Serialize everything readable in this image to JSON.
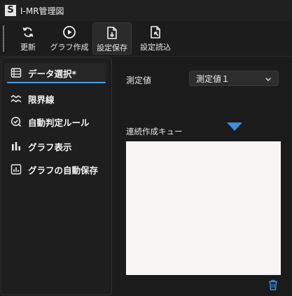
{
  "window": {
    "logo_letter": "S",
    "title": "I-MR管理図"
  },
  "toolbar": {
    "refresh_label": "更新",
    "create_chart_label": "グラフ作成",
    "save_settings_label": "設定保存",
    "load_settings_label": "設定読込"
  },
  "sidebar": {
    "items": [
      {
        "label": "データ選択*",
        "icon": "table-icon",
        "selected": true
      },
      {
        "label": "限界線",
        "icon": "wave-lines-icon"
      },
      {
        "label": "自動判定ルール",
        "icon": "check-circle-icon"
      },
      {
        "label": "グラフ表示",
        "icon": "bar-chart-icon"
      },
      {
        "label": "グラフの自動保存",
        "icon": "chart-save-icon"
      }
    ]
  },
  "main": {
    "measurement_label": "測定値",
    "measurement_select_value": "測定値１",
    "queue_label": "連続作成キュー"
  },
  "colors": {
    "accent": "#4a9fe0",
    "background": "#1b1b1b",
    "queue_background": "#f7f6f4"
  }
}
